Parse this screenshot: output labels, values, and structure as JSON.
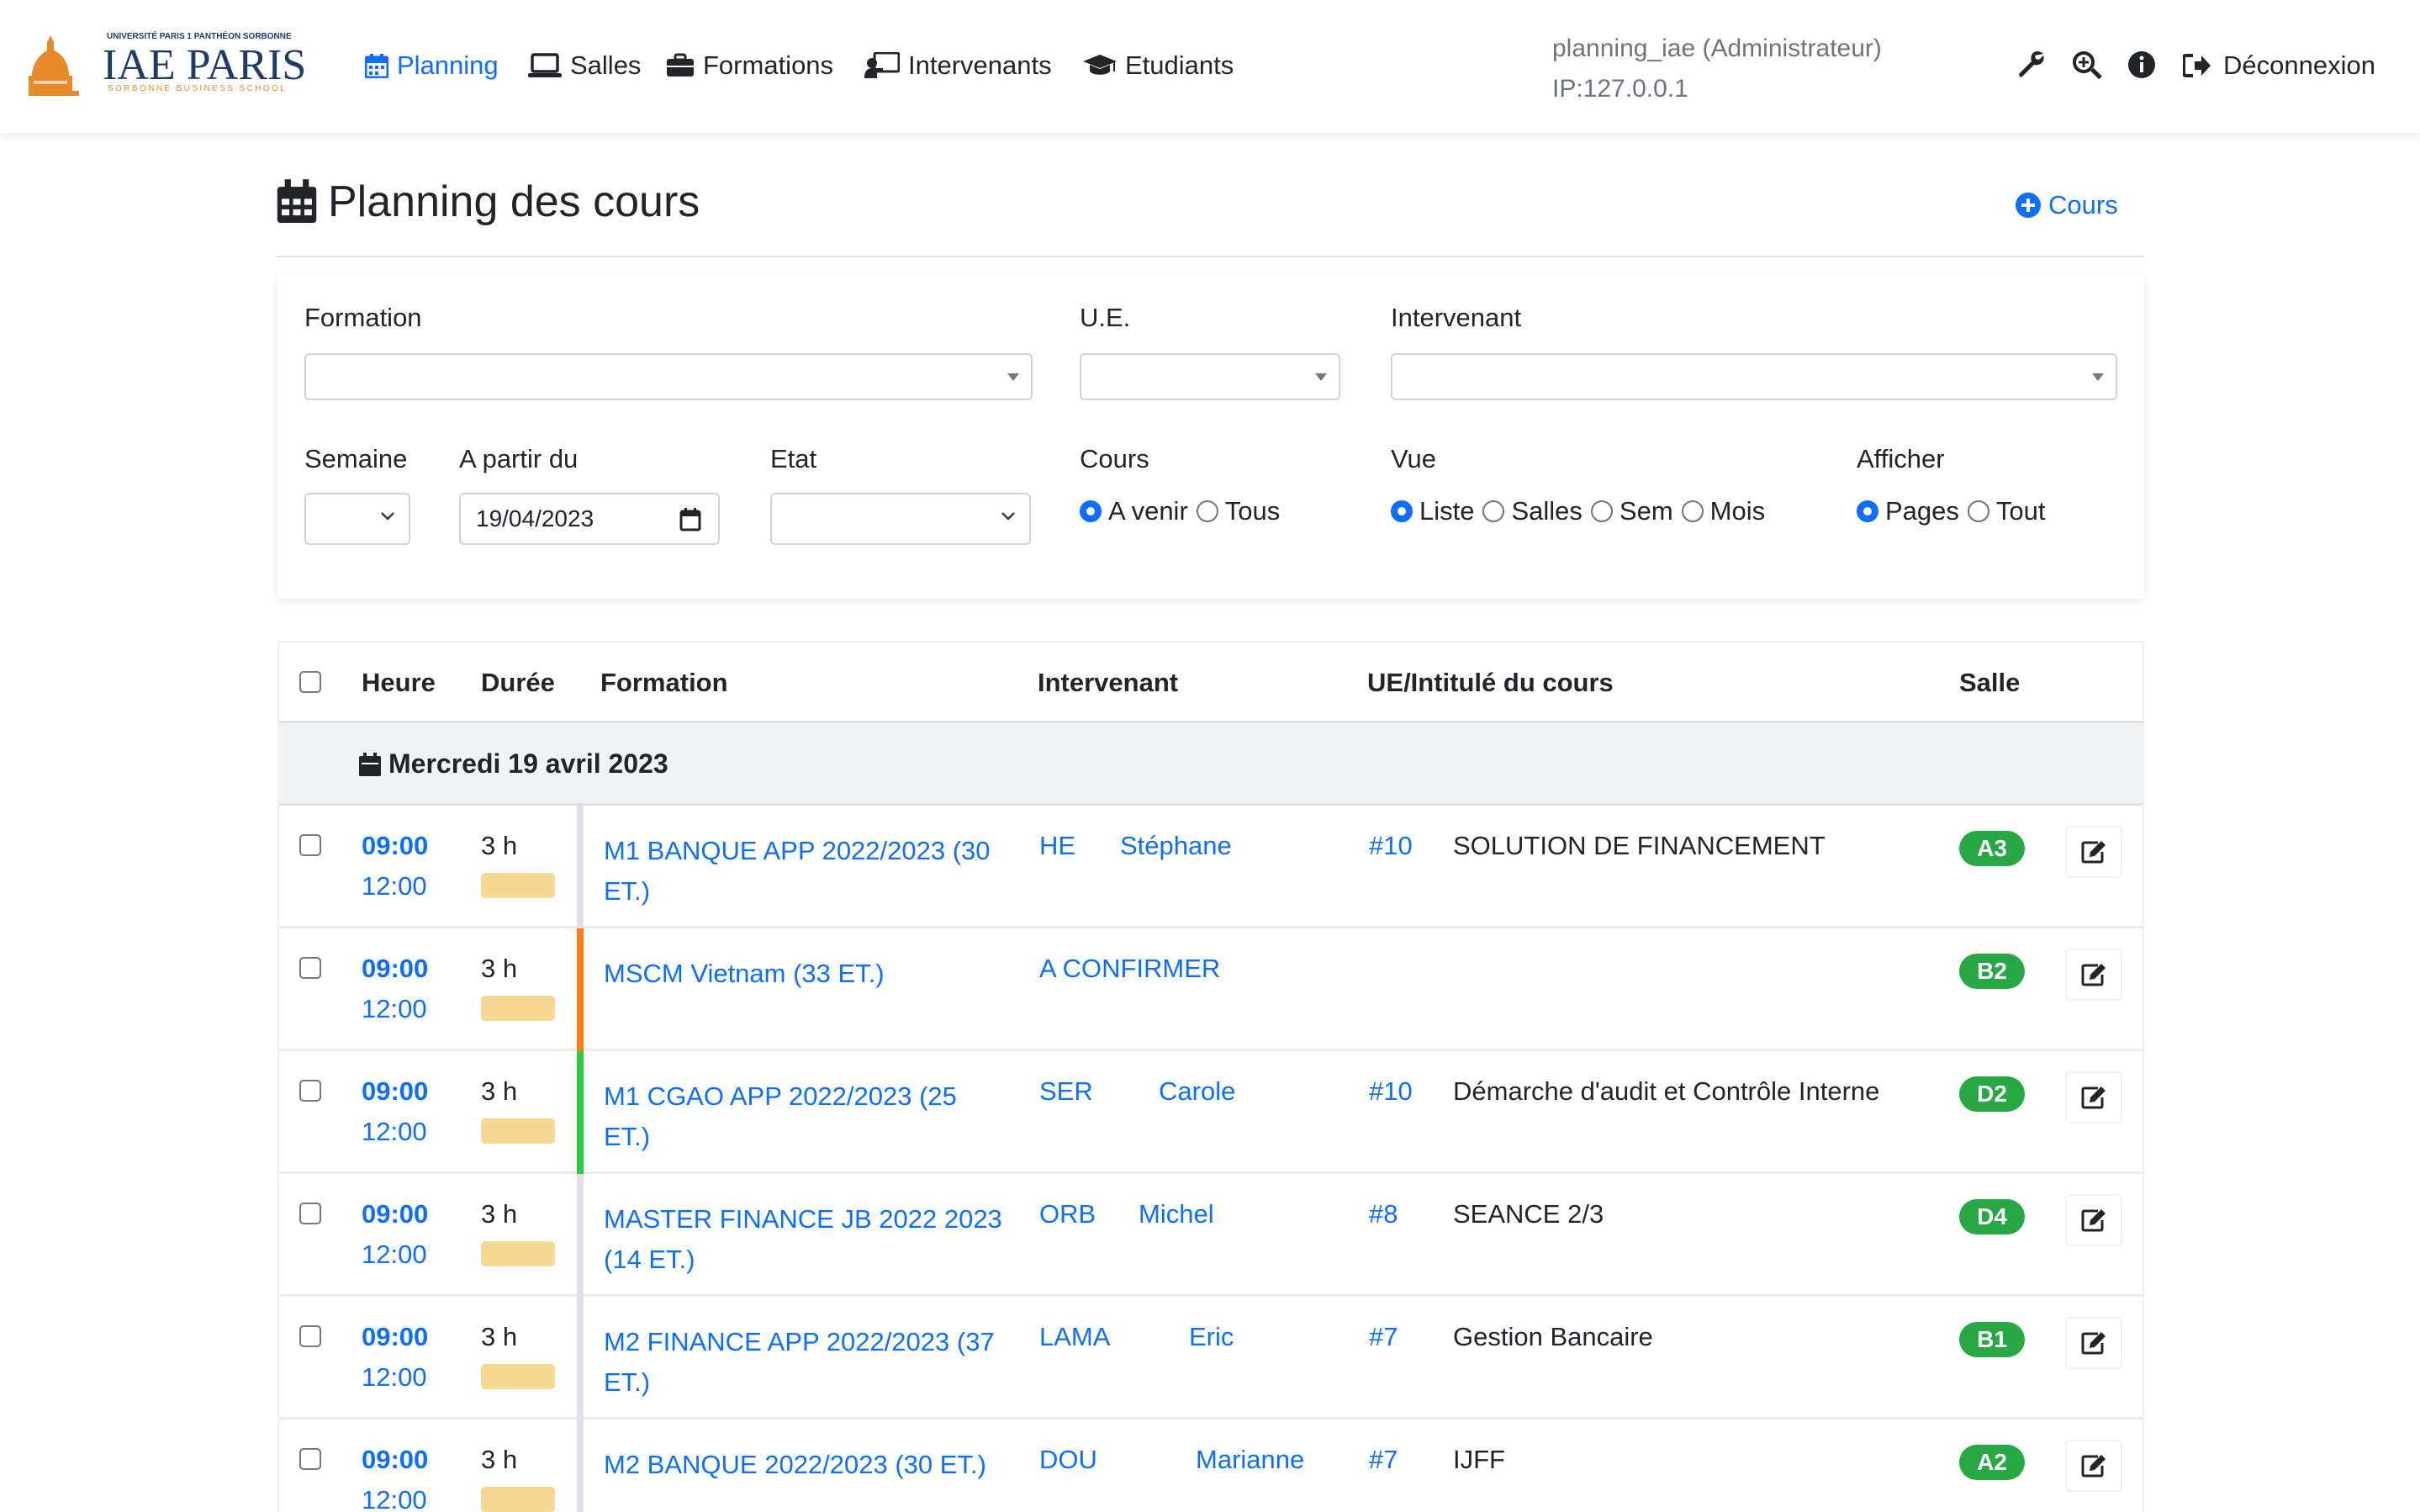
{
  "nav": {
    "logo": {
      "top_text": "UNIVERSITÉ PARIS 1 PANTHÉON SORBONNE",
      "main": "IAE PARIS",
      "sub": "SORBONNE BUSINESS SCHOOL"
    },
    "items": [
      {
        "label": "Planning",
        "icon": "calendar-icon",
        "active": true
      },
      {
        "label": "Salles",
        "icon": "laptop-icon"
      },
      {
        "label": "Formations",
        "icon": "briefcase-icon"
      },
      {
        "label": "Intervenants",
        "icon": "chalkboard-teacher-icon"
      },
      {
        "label": "Etudiants",
        "icon": "graduation-cap-icon"
      }
    ],
    "user": "planning_iae (Administrateur)",
    "ip": "IP:127.0.0.1",
    "tools": [
      "wrench-icon",
      "zoom-icon",
      "info-icon"
    ],
    "logout_label": "Déconnexion"
  },
  "page": {
    "title": "Planning des cours",
    "add_label": "Cours"
  },
  "filters": {
    "formation_label": "Formation",
    "ue_label": "U.E.",
    "intervenant_label": "Intervenant",
    "semaine_label": "Semaine",
    "a_partir_label": "A partir du",
    "a_partir_value": "19/04/2023",
    "etat_label": "Etat",
    "cours_label": "Cours",
    "cours_options": [
      "A venir",
      "Tous"
    ],
    "cours_selected": "A venir",
    "vue_label": "Vue",
    "vue_options": [
      "Liste",
      "Salles",
      "Sem",
      "Mois"
    ],
    "vue_selected": "Liste",
    "afficher_label": "Afficher",
    "afficher_options": [
      "Pages",
      "Tout"
    ],
    "afficher_selected": "Pages"
  },
  "table": {
    "headers": {
      "heure": "Heure",
      "duree": "Durée",
      "formation": "Formation",
      "intervenant": "Intervenant",
      "ue": "UE/Intitulé du cours",
      "salle": "Salle"
    },
    "date_label": "Mercredi 19 avril 2023",
    "stripe_colors": {
      "default": "#dee2e6",
      "orange": "#fd7e14",
      "green": "#2ecc40"
    },
    "rows": [
      {
        "start": "09:00",
        "end": "12:00",
        "duration": "3 h",
        "formation": "M1 BANQUE APP 2022/2023 (30 ET.)",
        "int_code": "HE",
        "int_name": "Stéphane",
        "ue": "#10",
        "course": "SOLUTION DE FINANCEMENT",
        "salle": "A3",
        "stripe": "default"
      },
      {
        "start": "09:00",
        "end": "12:00",
        "duration": "3 h",
        "formation": "MSCM Vietnam (33 ET.)",
        "int_code": "A CONFIRMER",
        "int_name": "",
        "ue": "",
        "course": "",
        "salle": "B2",
        "stripe": "orange"
      },
      {
        "start": "09:00",
        "end": "12:00",
        "duration": "3 h",
        "formation": "M1 CGAO APP 2022/2023 (25 ET.)",
        "int_code": "SER",
        "int_name": "Carole",
        "ue": "#10",
        "course": "Démarche d'audit et Contrôle Interne",
        "salle": "D2",
        "stripe": "green"
      },
      {
        "start": "09:00",
        "end": "12:00",
        "duration": "3 h",
        "formation": "MASTER FINANCE JB 2022 2023 (14 ET.)",
        "int_code": "ORB",
        "int_name": "Michel",
        "ue": "#8",
        "course": "SEANCE 2/3",
        "salle": "D4",
        "stripe": "default"
      },
      {
        "start": "09:00",
        "end": "12:00",
        "duration": "3 h",
        "formation": "M2 FINANCE APP 2022/2023 (37 ET.)",
        "int_code": "LAMA",
        "int_name": "Eric",
        "ue": "#7",
        "course": "Gestion Bancaire",
        "salle": "B1",
        "stripe": "default"
      },
      {
        "start": "09:00",
        "end": "12:00",
        "duration": "3 h",
        "formation": "M2 BANQUE 2022/2023 (30 ET.)",
        "int_code": "DOU",
        "int_name": "Marianne",
        "ue": "#7",
        "course": "IJFF",
        "salle": "A2",
        "stripe": "default"
      }
    ]
  }
}
